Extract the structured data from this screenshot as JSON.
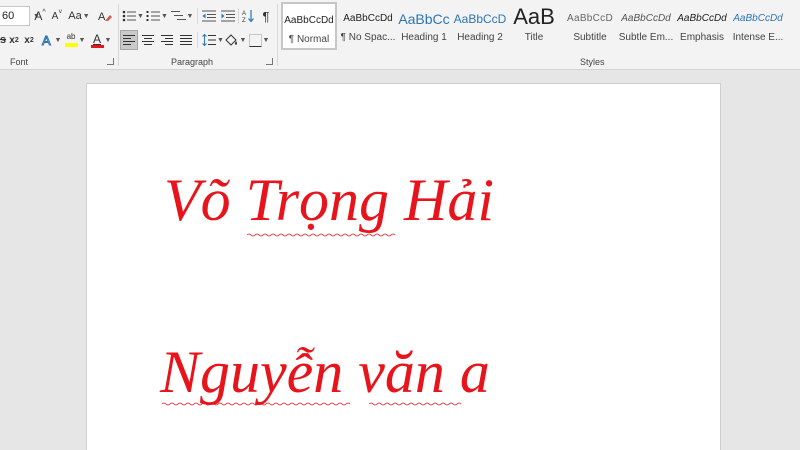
{
  "ribbon": {
    "font_group": {
      "label": "Font",
      "font_size": "60",
      "change_case_label": "Aa",
      "grow_font_label": "A",
      "shrink_font_label": "A",
      "subscript_label": "x",
      "subscript_sub": "2",
      "superscript_label": "x",
      "superscript_sup": "2",
      "highlight_label": "ab",
      "font_color_label": "A",
      "font_color": "#e8141c",
      "highlight_color": "#ffff00"
    },
    "paragraph_group": {
      "label": "Paragraph"
    },
    "styles_group": {
      "label": "Styles",
      "items": [
        {
          "preview": "AaBbCcDd",
          "name": "¶ Normal"
        },
        {
          "preview": "AaBbCcDd",
          "name": "¶ No Spac..."
        },
        {
          "preview": "AaBbCc",
          "name": "Heading 1"
        },
        {
          "preview": "AaBbCcD",
          "name": "Heading 2"
        },
        {
          "preview": "AaB",
          "name": "Title"
        },
        {
          "preview": "AaBbCcD",
          "name": "Subtitle"
        },
        {
          "preview": "AaBbCcDd",
          "name": "Subtle Em..."
        },
        {
          "preview": "AaBbCcDd",
          "name": "Emphasis"
        },
        {
          "preview": "AaBbCcDd",
          "name": "Intense E..."
        }
      ],
      "heading_color": "#2e74b5"
    }
  },
  "document": {
    "text_color": "#e8141c",
    "lines": [
      {
        "text": "Võ Trọng Hải"
      },
      {
        "text": "Nguyễn văn a"
      }
    ]
  }
}
